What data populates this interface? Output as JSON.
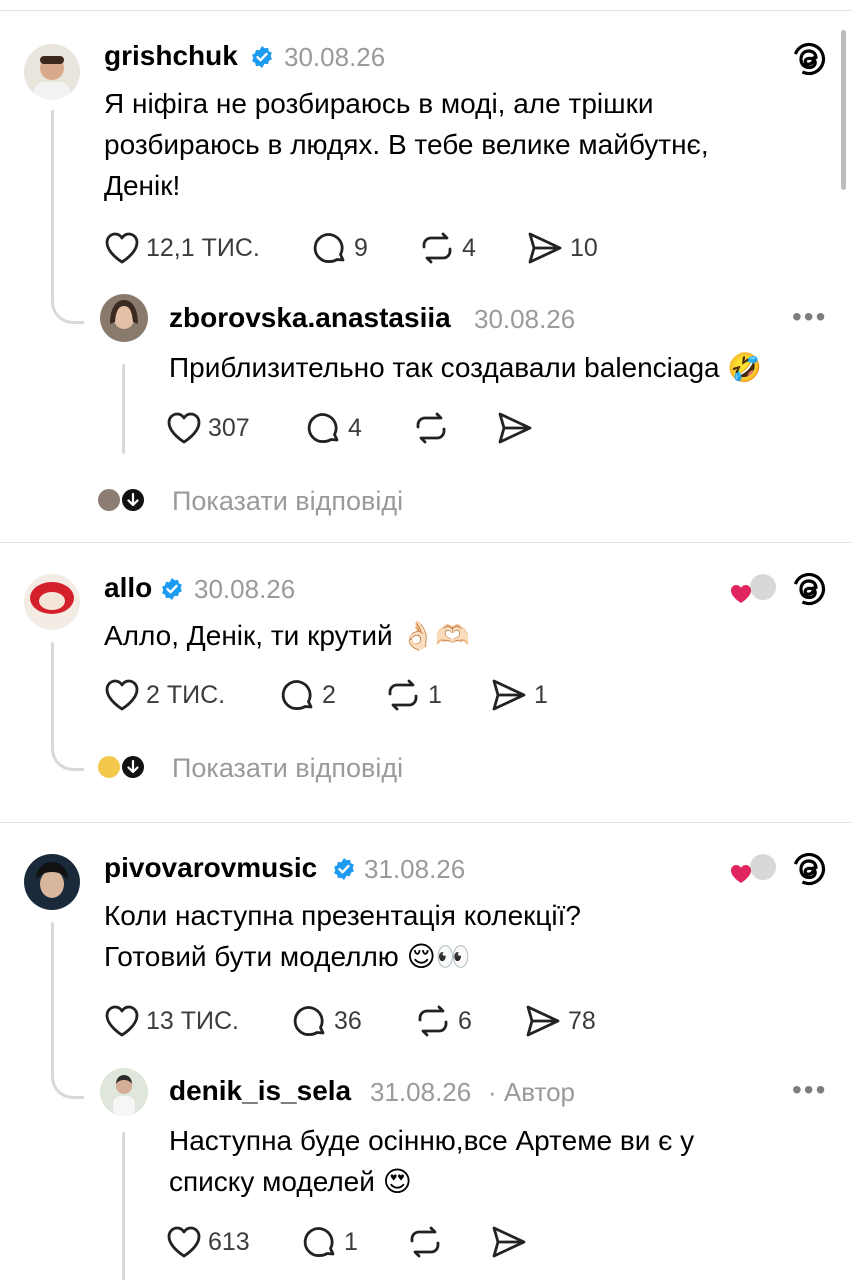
{
  "comments": [
    {
      "username": "grishchuk",
      "date": "30.08.26",
      "text_lines": [
        "Я ніфіга не розбираюсь в моді, але трішки",
        "розбираюсь в людях. В тебе велике майбутнє,",
        "Денік!"
      ],
      "likes": "12,1 ТИС.",
      "replies": "9",
      "reposts": "4",
      "shares": "10",
      "reply": {
        "username": "zborovska.anastasiia",
        "date": "30.08.26",
        "text": "Приблизительно так создавали balenciaga",
        "emoji": "🤣",
        "likes": "307",
        "replies": "4"
      },
      "show_replies": "Показати відповіді"
    },
    {
      "username": "allo",
      "date": "30.08.26",
      "text": "Алло, Денік, ти крутий",
      "emoji": "👌🏻🫶🏻",
      "likes": "2 ТИС.",
      "replies": "2",
      "reposts": "1",
      "shares": "1",
      "show_replies": "Показати відповіді"
    },
    {
      "username": "pivovarovmusic",
      "date": "31.08.26",
      "text_line1": "Коли наступна презентація колекції?",
      "text_line2": "Готовий бути моделлю",
      "emoji": "😌👀",
      "likes": "13 ТИС.",
      "replies": "36",
      "reposts": "6",
      "shares": "78",
      "reply": {
        "username": "denik_is_sela",
        "date": "31.08.26",
        "author_tag": "· Автор",
        "text_line1": "Наступна буде осінню,все Артеме ви є у",
        "text_line2": "списку моделей",
        "emoji": "😍",
        "likes": "613",
        "replies": "1"
      }
    }
  ],
  "icons": {
    "verified": "verified-badge-icon",
    "like": "heart-icon",
    "reply": "comment-icon",
    "repost": "repost-icon",
    "share": "send-icon",
    "more": "more-dots-icon",
    "threads": "threads-logo-icon",
    "expand": "arrow-down-icon"
  },
  "colors": {
    "verified": "#1d9bf0",
    "secondary_text": "#9a9a9a",
    "liked_heart": "#e0245e"
  },
  "more_glyph": "•••"
}
